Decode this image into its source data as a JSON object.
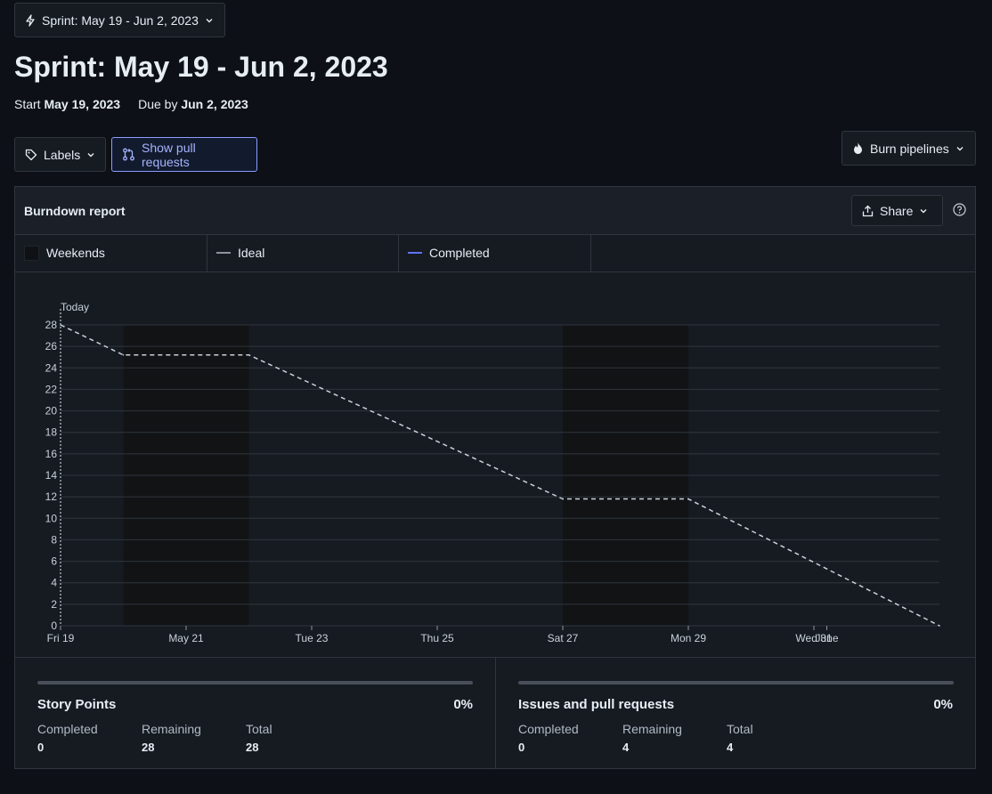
{
  "sprint_selector": {
    "label": "Sprint: May 19 - Jun 2, 2023"
  },
  "page": {
    "title": "Sprint: May 19 - Jun 2, 2023",
    "start_label": "Start",
    "start_date": "May 19, 2023",
    "due_label": "Due by",
    "due_date": "Jun 2, 2023"
  },
  "toolbar": {
    "labels_button": "Labels",
    "show_prs_button": "Show pull requests",
    "burn_pipelines_button": "Burn pipelines"
  },
  "report": {
    "title": "Burndown report",
    "share_button": "Share",
    "legend": {
      "weekends": "Weekends",
      "ideal": "Ideal",
      "completed": "Completed"
    },
    "colors": {
      "ideal": "#c9d1d9",
      "completed": "#6272ff",
      "weekend": "#111315",
      "grid": "#30363d"
    }
  },
  "chart_data": {
    "type": "line",
    "today_label": "Today",
    "x_tick_labels": [
      "Fri 19",
      "May 21",
      "Tue 23",
      "Thu 25",
      "Sat 27",
      "Mon 29",
      "Wed 31",
      "June"
    ],
    "x_domain": [
      "2023-05-19",
      "2023-06-02"
    ],
    "ylim": [
      0,
      28
    ],
    "y_ticks": [
      0,
      2,
      4,
      6,
      8,
      10,
      12,
      14,
      16,
      18,
      20,
      22,
      24,
      26,
      28
    ],
    "weekends": [
      [
        "2023-05-20",
        "2023-05-22"
      ],
      [
        "2023-05-27",
        "2023-05-29"
      ]
    ],
    "series": [
      {
        "name": "Ideal",
        "style": "dashed",
        "points": [
          {
            "x": "2023-05-19",
            "y": 28
          },
          {
            "x": "2023-05-20",
            "y": 25.2
          },
          {
            "x": "2023-05-22",
            "y": 25.2
          },
          {
            "x": "2023-05-27",
            "y": 11.8
          },
          {
            "x": "2023-05-29",
            "y": 11.8
          },
          {
            "x": "2023-06-02",
            "y": 0
          }
        ]
      },
      {
        "name": "Completed",
        "points": []
      }
    ]
  },
  "stats": {
    "story_points": {
      "title": "Story Points",
      "percent": "0%",
      "progress": 0,
      "completed_label": "Completed",
      "completed": "0",
      "remaining_label": "Remaining",
      "remaining": "28",
      "total_label": "Total",
      "total": "28"
    },
    "issues": {
      "title": "Issues and pull requests",
      "percent": "0%",
      "progress": 0,
      "completed_label": "Completed",
      "completed": "0",
      "remaining_label": "Remaining",
      "remaining": "4",
      "total_label": "Total",
      "total": "4"
    }
  }
}
